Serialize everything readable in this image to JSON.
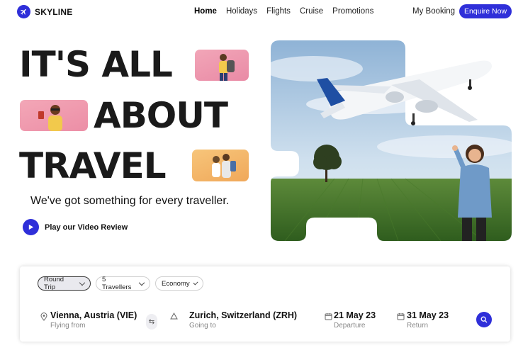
{
  "brand": {
    "name": "SKYLINE",
    "logo_icon": "plane-icon"
  },
  "nav": {
    "items": [
      {
        "label": "Home",
        "active": true
      },
      {
        "label": "Holidays",
        "active": false
      },
      {
        "label": "Flights",
        "active": false
      },
      {
        "label": "Cruise",
        "active": false
      },
      {
        "label": "Promotions",
        "active": false
      }
    ],
    "my_booking": "My Booking",
    "enquire": "Enquire Now"
  },
  "hero": {
    "line1": "IT'S ALL",
    "line2": "ABOUT",
    "line3": "TRAVEL",
    "tagline": "We've got something for every traveller.",
    "video_label": "Play our Video Review"
  },
  "search": {
    "chips": [
      {
        "label": "Round Trip",
        "selected": true
      },
      {
        "label": "5 Travellers",
        "selected": false
      },
      {
        "label": "Economy",
        "selected": false
      }
    ],
    "from": {
      "value": "Vienna, Austria (VIE)",
      "label": "Flying from"
    },
    "to": {
      "value": "Zurich, Switzerland (ZRH)",
      "label": "Going to"
    },
    "departure": {
      "value": "21 May 23",
      "label": "Departure"
    },
    "return": {
      "value": "31 May 23",
      "label": "Return"
    }
  },
  "colors": {
    "accent": "#2f2fd9",
    "text": "#1a1a1a",
    "muted": "#888888"
  }
}
